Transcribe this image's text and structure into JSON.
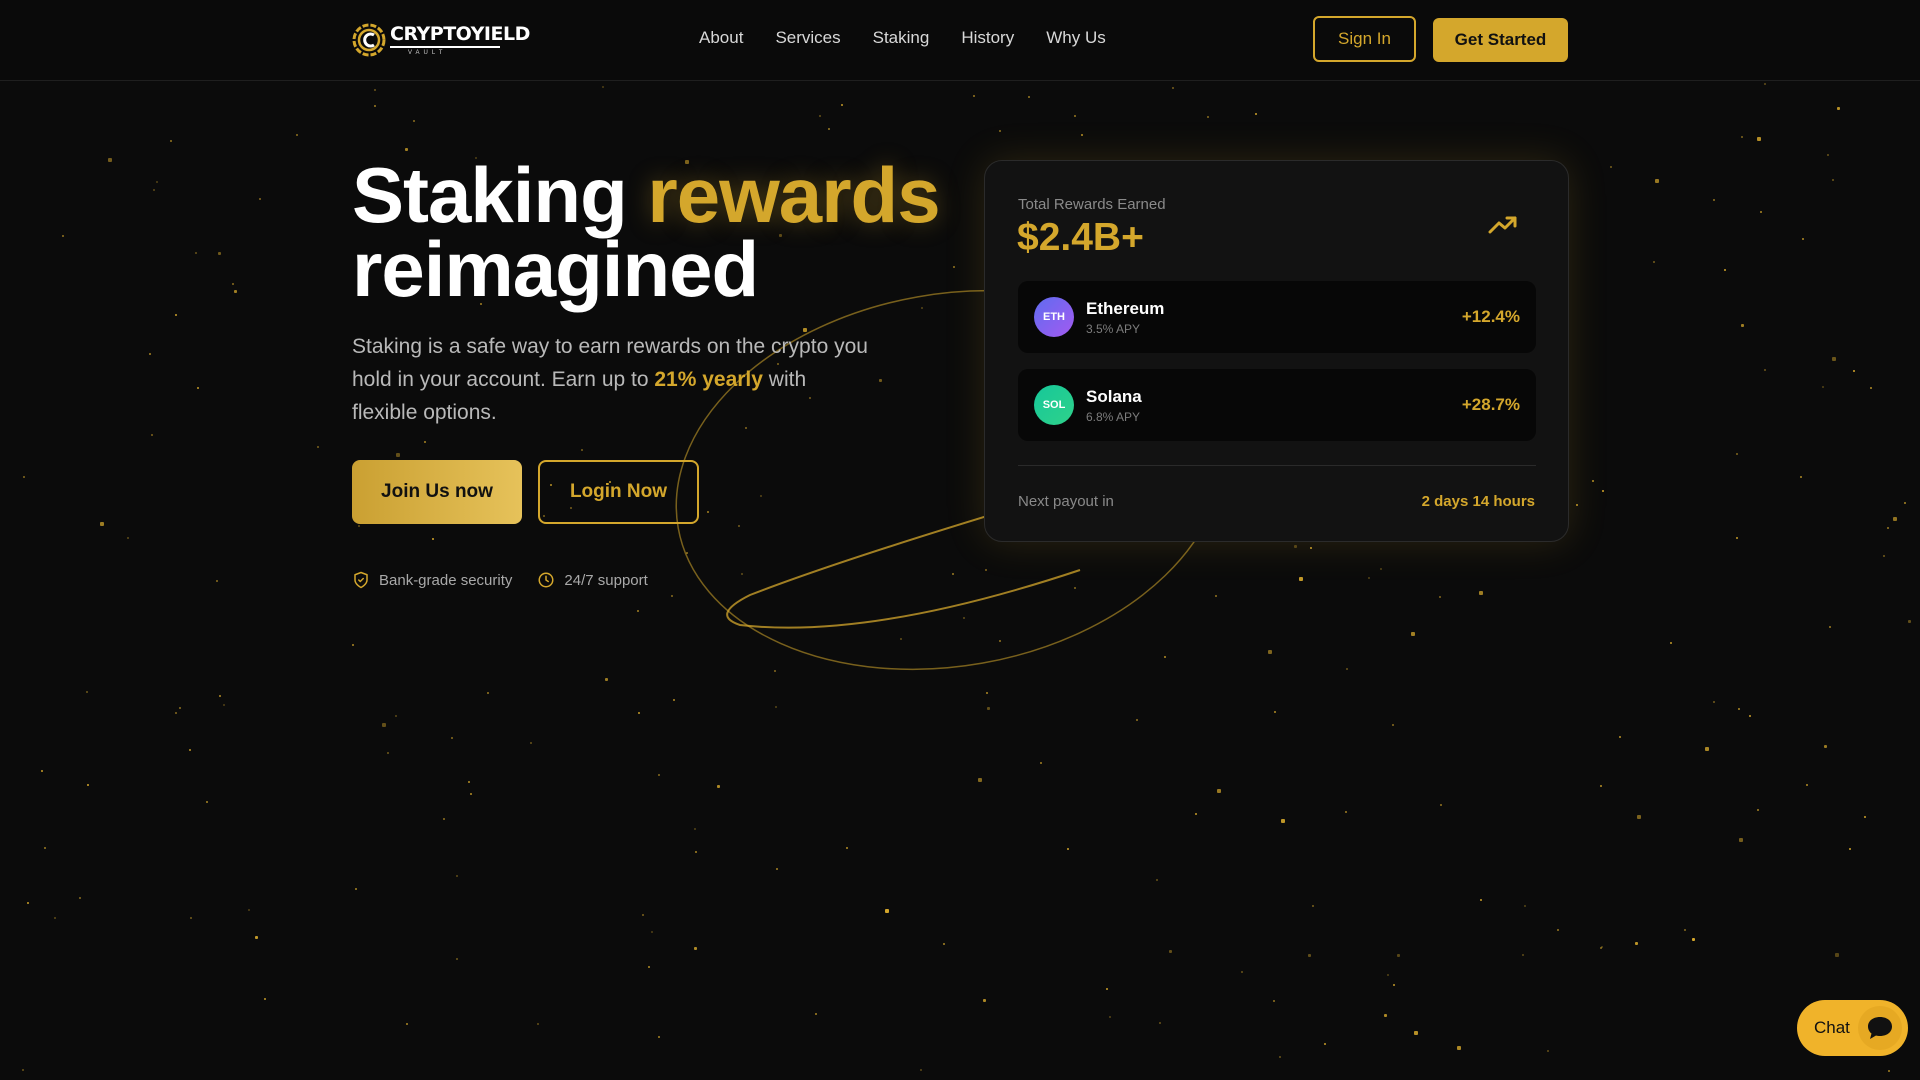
{
  "brand": {
    "name_part1": "CRYPTO",
    "name_part2": "YIELD",
    "tagline": "VAULT"
  },
  "nav": {
    "links": [
      "About",
      "Services",
      "Staking",
      "History",
      "Why Us"
    ],
    "sign_in": "Sign In",
    "get_started": "Get Started"
  },
  "hero": {
    "title_word1": "Staking",
    "title_word2": "rewards",
    "title_line2": "reimagined",
    "subtext_before": "Staking is a safe way to earn rewards on the crypto you hold in your account. Earn up to ",
    "subtext_highlight": "21% yearly",
    "subtext_after": " with flexible options.",
    "join_button": "Join Us now",
    "login_button": "Login Now",
    "features": [
      {
        "label": "Bank-grade security",
        "icon": "shield-check-icon"
      },
      {
        "label": "24/7 support",
        "icon": "clock-icon"
      }
    ]
  },
  "card": {
    "label": "Total Rewards Earned",
    "value": "$2.4B+",
    "trend_icon": "trending-up-icon",
    "assets": [
      {
        "symbol": "ETH",
        "name": "Ethereum",
        "apy": "3.5% APY",
        "change": "+12.4%"
      },
      {
        "symbol": "SOL",
        "name": "Solana",
        "apy": "6.8% APY",
        "change": "+28.7%"
      }
    ],
    "payout_label": "Next payout in",
    "payout_value": "2 days 14 hours"
  },
  "chat": {
    "label": "Chat",
    "icon": "chat-bubble-icon"
  },
  "colors": {
    "accent": "#d4a72c",
    "background": "#0b0b0b",
    "card": "#121212",
    "chat": "#f0b32a"
  }
}
